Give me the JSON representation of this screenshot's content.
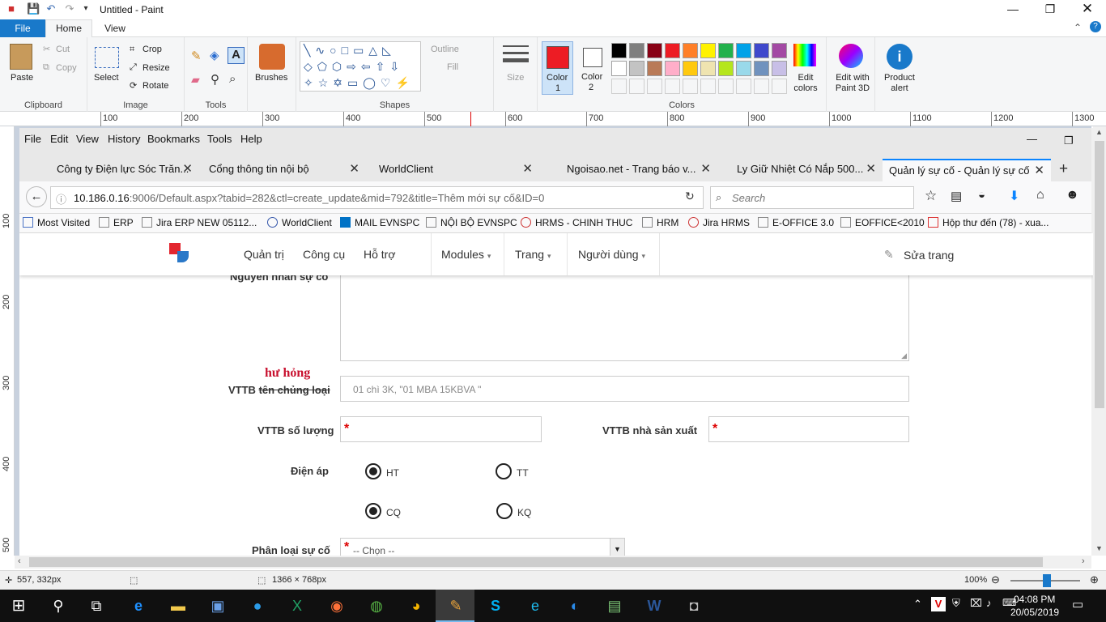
{
  "window": {
    "title": "Untitled - Paint"
  },
  "ribbon": {
    "tabs": [
      "File",
      "Home",
      "View"
    ],
    "clipboard": {
      "paste": "Paste",
      "cut": "Cut",
      "copy": "Copy",
      "label": "Clipboard"
    },
    "image": {
      "select": "Select",
      "crop": "Crop",
      "resize": "Resize",
      "rotate": "Rotate",
      "label": "Image"
    },
    "tools": {
      "label": "Tools"
    },
    "brushes": {
      "label": "Brushes"
    },
    "shapes": {
      "outline": "Outline",
      "fill": "Fill",
      "label": "Shapes"
    },
    "size": {
      "label": "Size"
    },
    "colors": {
      "color1": "Color",
      "color1_num": "1",
      "color2": "Color",
      "color2_num": "2",
      "label": "Colors",
      "edit_colors": "Edit colors",
      "edit_3d": "Edit with Paint 3D",
      "product_alert": "Product alert"
    },
    "palette_row1": [
      "#000000",
      "#7f7f7f",
      "#880015",
      "#ed1c24",
      "#ff7f27",
      "#fff200",
      "#22b14c",
      "#00a2e8",
      "#3f48cc",
      "#a349a4"
    ],
    "palette_row2": [
      "#ffffff",
      "#c3c3c3",
      "#b97a57",
      "#ffaec9",
      "#ffc90e",
      "#efe4b0",
      "#b5e61d",
      "#99d9ea",
      "#7092be",
      "#c8bfe7"
    ],
    "color1_value": "#ed1c24",
    "color2_value": "#ffffff"
  },
  "ruler": {
    "marks": [
      "100",
      "200",
      "300",
      "400",
      "500",
      "600",
      "700",
      "800",
      "900",
      "1000",
      "1100",
      "1200",
      "1300"
    ],
    "vmarks": [
      "100",
      "200",
      "300",
      "400",
      "500"
    ]
  },
  "browser": {
    "menu": [
      "File",
      "Edit",
      "View",
      "History",
      "Bookmarks",
      "Tools",
      "Help"
    ],
    "tabs": [
      {
        "label": "Công ty Điện lực Sóc Trăn..."
      },
      {
        "label": "Cổng thông tin nội bộ"
      },
      {
        "label": "WorldClient"
      },
      {
        "label": "Ngoisao.net - Trang báo v..."
      },
      {
        "label": "Ly Giữ Nhiệt Có Nắp 500..."
      },
      {
        "label": "Quản lý sự cố - Quản lý sự cố"
      }
    ],
    "new_tab": "+",
    "url": "10.186.0.16",
    "url_rest": ":9006/Default.aspx?tabid=282&ctl=create_update&mid=792&title=Thêm mới sự cố&ID=0",
    "search_placeholder": "Search",
    "bookmarks": [
      "Most Visited",
      "ERP",
      "Jira ERP NEW 05112...",
      "WorldClient",
      "MAIL EVNSPC",
      "NỘI BỘ EVNSPC",
      "HRMS - CHINH THUC",
      "HRM",
      "Jira HRMS",
      "E-OFFICE 3.0",
      "EOFFICE<2010",
      "Hộp thư đến (78) - xua..."
    ]
  },
  "site": {
    "nav": [
      "Quản trị",
      "Công cụ",
      "Hỗ trợ",
      "Modules",
      "Trang",
      "Người dùng"
    ],
    "edit_page": "Sửa trang",
    "fields": {
      "cause_label": "Nguyên nhân sự cố",
      "annotation": "hư hỏng",
      "vttb_type_label_a": "VTTB ",
      "vttb_type_label_b": "tên chủng loại",
      "vttb_type_placeholder": "01 chì 3K, \"01 MBA 15KBVA \"",
      "vttb_qty_label": "VTTB số lượng",
      "vttb_maker_label": "VTTB nhà sản xuất",
      "voltage_label": "Điện áp",
      "radio_ht": "HT",
      "radio_tt": "TT",
      "radio_cq": "CQ",
      "radio_kq": "KQ",
      "classification_label": "Phân loại sự cố",
      "classification_value": "-- Chọn --",
      "required_mark": "*"
    }
  },
  "status": {
    "coords": "557, 332px",
    "size": "1366 × 768px",
    "zoom": "100%"
  },
  "taskbar": {
    "time": "04:08 PM",
    "date": "20/05/2019"
  }
}
